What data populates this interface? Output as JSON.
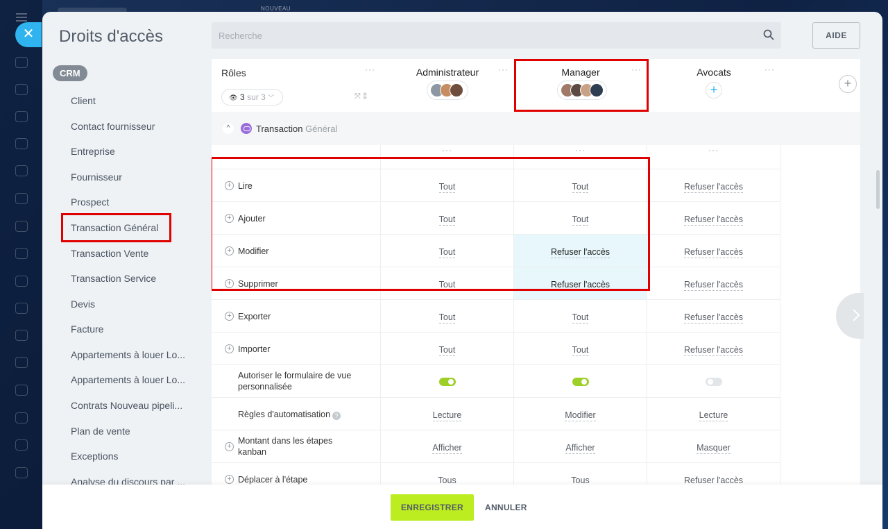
{
  "topbar": {
    "tag": "NOUVEAU"
  },
  "header": {
    "title": "Droits d'accès",
    "search_placeholder": "Recherche",
    "help_label": "AIDE"
  },
  "sidebar": {
    "badge": "CRM",
    "items": [
      {
        "label": "Client"
      },
      {
        "label": "Contact fournisseur"
      },
      {
        "label": "Entreprise"
      },
      {
        "label": "Fournisseur"
      },
      {
        "label": "Prospect"
      },
      {
        "label": "Transaction Général"
      },
      {
        "label": "Transaction Vente"
      },
      {
        "label": "Transaction Service"
      },
      {
        "label": "Devis"
      },
      {
        "label": "Facture"
      },
      {
        "label": "Appartements à louer Lo..."
      },
      {
        "label": "Appartements à louer Lo..."
      },
      {
        "label": "Contrats Nouveau pipeli..."
      },
      {
        "label": "Plan de vente"
      },
      {
        "label": "Exceptions"
      },
      {
        "label": "Analyse du discours par ..."
      }
    ]
  },
  "table": {
    "roles_label": "Rôles",
    "count": {
      "num": "3",
      "rest": "sur 3"
    },
    "columns": [
      {
        "title": "Administrateur"
      },
      {
        "title": "Manager"
      },
      {
        "title": "Avocats"
      }
    ],
    "group": {
      "name": "Transaction",
      "sub": "Général"
    },
    "rows": [
      {
        "name": "Lire",
        "values": [
          "Tout",
          "Tout",
          "Refuser l'accès"
        ]
      },
      {
        "name": "Ajouter",
        "values": [
          "Tout",
          "Tout",
          "Refuser l'accès"
        ]
      },
      {
        "name": "Modifier",
        "values": [
          "Tout",
          "Refuser l'accès",
          "Refuser l'accès"
        ]
      },
      {
        "name": "Supprimer",
        "values": [
          "Tout",
          "Refuser l'accès",
          "Refuser l'accès"
        ]
      },
      {
        "name": "Exporter",
        "values": [
          "Tout",
          "Tout",
          "Refuser l'accès"
        ]
      },
      {
        "name": "Importer",
        "values": [
          "Tout",
          "Tout",
          "Refuser l'accès"
        ]
      },
      {
        "name": "Autoriser le formulaire de vue personnalisée",
        "toggles": [
          true,
          true,
          false
        ]
      },
      {
        "name": "Règles d'automatisation",
        "values": [
          "Lecture",
          "Modifier",
          "Lecture"
        ]
      },
      {
        "name": "Montant dans les étapes kanban",
        "values": [
          "Afficher",
          "Afficher",
          "Masquer"
        ]
      },
      {
        "name": "Déplacer à l'étape",
        "values": [
          "Tous",
          "Tous",
          "Refuser l'accès"
        ]
      }
    ]
  },
  "footer": {
    "save_label": "ENREGISTRER",
    "cancel_label": "ANNULER"
  },
  "colors": {
    "accent": "#2fb4f0",
    "save": "#bbed21",
    "highlight": "#e00000",
    "toggle_on": "#9dcf26"
  }
}
